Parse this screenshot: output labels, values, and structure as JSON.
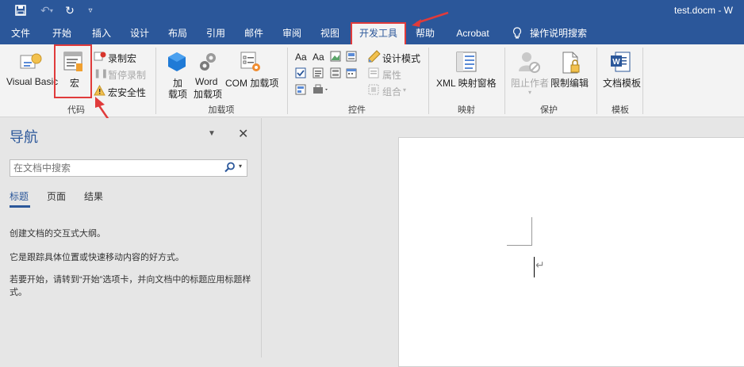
{
  "window": {
    "doc_title": "test.docm - W"
  },
  "qat": {
    "save_icon": "save-icon",
    "undo_icon": "undo-icon",
    "redo_icon": "redo-icon",
    "customize_icon": "chevron-down-icon"
  },
  "tabs": [
    "文件",
    "开始",
    "插入",
    "设计",
    "布局",
    "引用",
    "邮件",
    "审阅",
    "视图",
    "开发工具",
    "帮助",
    "Acrobat",
    "操作说明搜索"
  ],
  "ribbon": {
    "code": {
      "visual_basic": "Visual Basic",
      "macros": "宏",
      "record_macro": "录制宏",
      "pause_recording": "暂停录制",
      "macro_security": "宏安全性",
      "group": "代码"
    },
    "addins": {
      "addins_line1": "加",
      "addins_line2": "载项",
      "word_line1": "Word",
      "word_line2": "加载项",
      "com": "COM 加载项",
      "group": "加载项"
    },
    "controls": {
      "aa1": "Aa",
      "aa2": "Aa",
      "design_mode": "设计模式",
      "properties": "属性",
      "group_btn": "组合",
      "group": "控件"
    },
    "mapping": {
      "xml": "XML 映射窗格",
      "group": "映射"
    },
    "protect": {
      "block_authors": "阻止作者",
      "restrict_editing": "限制编辑",
      "group": "保护"
    },
    "templates": {
      "doc_template": "文档模板",
      "group": "模板"
    }
  },
  "nav": {
    "title": "导航",
    "search_placeholder": "在文档中搜索",
    "tabs": [
      "标题",
      "页面",
      "结果"
    ],
    "p1": "创建文档的交互式大纲。",
    "p2": "它是跟踪具体位置或快速移动内容的好方式。",
    "p3": "若要开始，请转到“开始”选项卡，并向文档中的标题应用标题样式。"
  },
  "colors": {
    "accent": "#2b579a",
    "highlight": "#e03b3b"
  }
}
